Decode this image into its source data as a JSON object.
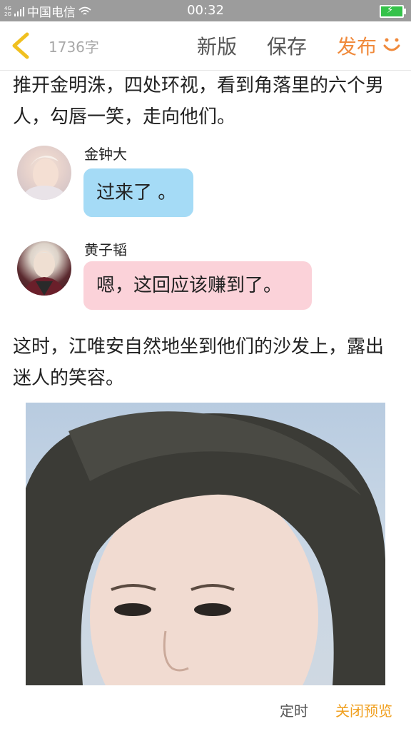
{
  "status_bar": {
    "network_top": "4G",
    "network_bottom": "2G",
    "carrier": "中国电信",
    "time": "00:32"
  },
  "toolbar": {
    "word_count": "1736字",
    "new_version": "新版",
    "save": "保存",
    "publish": "发布"
  },
  "content": {
    "paragraph_1": "推开金明洙，四处环视，看到角落里的六个男人，勾唇一笑，走向他们。",
    "messages": [
      {
        "speaker": "金钟大",
        "text": "过来了 。",
        "bubble_color": "#a5dbf6"
      },
      {
        "speaker": "黄子韬",
        "text": "嗯，这回应该赚到了。",
        "bubble_color": "#fbd2d9"
      }
    ],
    "paragraph_2": "这时，江唯安自然地坐到他们的沙发上，露出迷人的笑容。"
  },
  "bottom_bar": {
    "timer": "定时",
    "close_preview": "关闭预览"
  },
  "colors": {
    "accent": "#f08a3c",
    "close_preview": "#f0a020",
    "status_bar": "#9c9c9c"
  }
}
